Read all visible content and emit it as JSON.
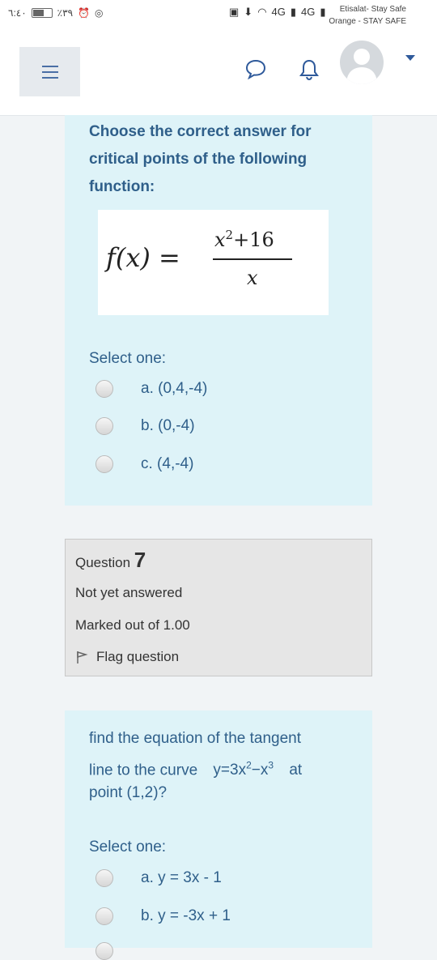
{
  "status_bar": {
    "time": "٦:٤٠",
    "battery": "٪٣٩",
    "network_1": "4G",
    "network_2": "4G",
    "carrier_1": "Etisalat- Stay Safe",
    "carrier_2": "Orange - STAY SAFE"
  },
  "header": {
    "menu_icon": "hamburger-icon",
    "chat_icon": "chat-bubble-icon",
    "bell_icon": "bell-icon",
    "avatar_icon": "user-avatar-icon",
    "dropdown_icon": "caret-down-icon"
  },
  "question6": {
    "prompt_lines": [
      "Choose the correct answer for",
      "critical points of the following",
      "function:"
    ],
    "formula": {
      "lhs": "f(x) =",
      "numerator": "x",
      "numerator_exp": "2",
      "numerator_tail": "+16",
      "denominator": "x"
    },
    "select_label": "Select one:",
    "options": [
      "a. (0,4,-4)",
      "b. (0,-4)",
      "c. (4,-4)"
    ]
  },
  "question7_info": {
    "label": "Question",
    "number": "7",
    "status": "Not yet answered",
    "marks": "Marked out of 1.00",
    "flag": "Flag question"
  },
  "question7": {
    "prompt_line1": "find the equation of the tangent",
    "prompt_line2_start": "line to the curve",
    "curve_y": "y=3x",
    "curve_exp1": "2",
    "curve_minus": "−x",
    "curve_exp2": "3",
    "prompt_line2_end": "at",
    "prompt_line3": "point (1,2)?",
    "select_label": "Select one:",
    "options": [
      "a. y = 3x - 1",
      "b. y = -3x + 1"
    ]
  },
  "colors": {
    "question_bg": "#def3f8",
    "question_text": "#2f5f8a",
    "info_bg": "#e6e6e6",
    "accent": "#2f5a9b"
  }
}
